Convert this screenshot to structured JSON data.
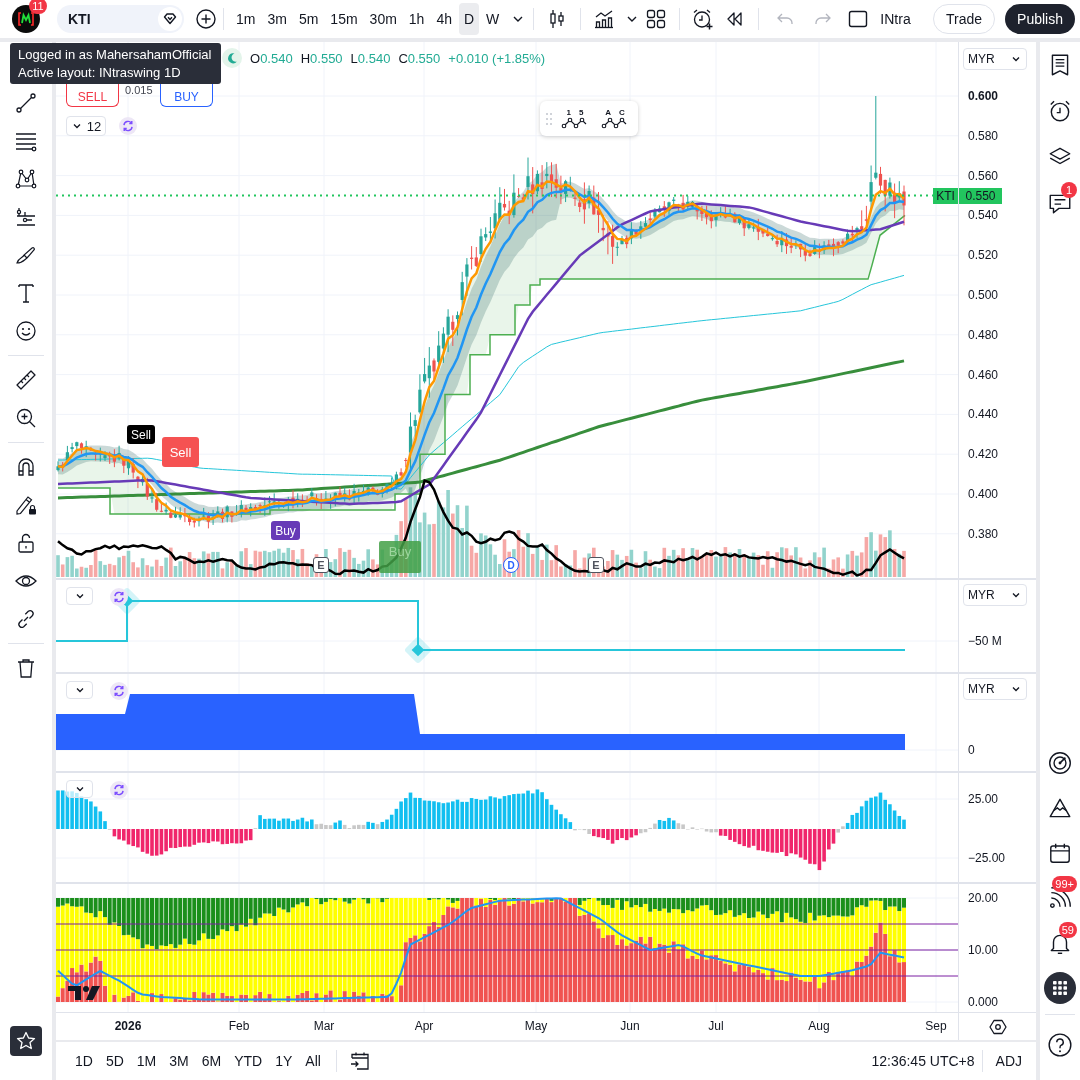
{
  "top_bar": {
    "avatar_badge": "11",
    "symbol": "KTI",
    "intervals": [
      {
        "label": "1m",
        "selected": false
      },
      {
        "label": "3m",
        "selected": false
      },
      {
        "label": "5m",
        "selected": false
      },
      {
        "label": "15m",
        "selected": false
      },
      {
        "label": "30m",
        "selected": false
      },
      {
        "label": "1h",
        "selected": false
      },
      {
        "label": "4h",
        "selected": false
      },
      {
        "label": "D",
        "selected": true
      },
      {
        "label": "W",
        "selected": false
      }
    ],
    "history_buttons": [
      {
        "kind": "undo",
        "disabled": true
      },
      {
        "kind": "redo",
        "disabled": true
      }
    ],
    "layout_name": "INtra",
    "actions": [
      {
        "label": "Trade",
        "kind": "secondary"
      },
      {
        "label": "Publish",
        "kind": "primary"
      }
    ]
  },
  "tooltip": {
    "lines": [
      "Logged in as MahersahamOfficial",
      "Active layout: INtraswing 1D"
    ]
  },
  "legend": {
    "ohlc": [
      {
        "label": "O",
        "value": "0.540"
      },
      {
        "label": "H",
        "value": "0.550"
      },
      {
        "label": "L",
        "value": "0.540"
      },
      {
        "label": "C",
        "value": "0.550"
      }
    ],
    "change": "+0.010 (+1.85%)"
  },
  "order_buttons": [
    {
      "kind": "sell",
      "label": "SELL"
    },
    {
      "kind": "buy",
      "label": "BUY"
    }
  ],
  "spread": "0.015",
  "indicator_count": "12",
  "wave_tools": [
    {
      "labels": [
        "1",
        "5"
      ]
    },
    {
      "labels": [
        "A",
        "C"
      ]
    }
  ],
  "chart_markers": [
    {
      "kind": "tag",
      "label": "Sell"
    },
    {
      "kind": "flag",
      "label": "Sell"
    },
    {
      "kind": "pill",
      "label": "Buy"
    },
    {
      "kind": "earnings",
      "label": "E"
    },
    {
      "kind": "dividend",
      "label": "D"
    },
    {
      "kind": "earnings",
      "label": "E"
    },
    {
      "kind": "block",
      "label": "Buy"
    }
  ],
  "price_axis": {
    "currency": "MYR",
    "ticks": [
      {
        "label": "0.600",
        "highlighted": true
      },
      {
        "label": "0.580",
        "highlighted": false
      },
      {
        "label": "0.560",
        "highlighted": false
      },
      {
        "label": "0.540",
        "highlighted": false
      },
      {
        "label": "0.520",
        "highlighted": false
      },
      {
        "label": "0.500",
        "highlighted": false
      },
      {
        "label": "0.480",
        "highlighted": false
      },
      {
        "label": "0.460",
        "highlighted": false
      },
      {
        "label": "0.440",
        "highlighted": false
      },
      {
        "label": "0.420",
        "highlighted": false
      },
      {
        "label": "0.400",
        "highlighted": false
      },
      {
        "label": "0.380",
        "highlighted": false
      }
    ],
    "last_price": {
      "symbol": "KTI",
      "value": "0.550"
    }
  },
  "sub_panes": [
    {
      "currency": "MYR",
      "ticks": [
        "−50 M"
      ]
    },
    {
      "currency": "MYR",
      "ticks": [
        "0"
      ]
    },
    {
      "ticks": [
        "25.00",
        "−25.00"
      ]
    },
    {
      "ticks": [
        "20.00",
        "10.00",
        "0.000"
      ]
    }
  ],
  "time_axis": [
    {
      "label": "2026",
      "kind": "year"
    },
    {
      "label": "Feb",
      "kind": "month"
    },
    {
      "label": "Mar",
      "kind": "month"
    },
    {
      "label": "Apr",
      "kind": "month"
    },
    {
      "label": "May",
      "kind": "month"
    },
    {
      "label": "Jun",
      "kind": "month"
    },
    {
      "label": "Jul",
      "kind": "month"
    },
    {
      "label": "Aug",
      "kind": "month"
    },
    {
      "label": "Sep",
      "kind": "month"
    }
  ],
  "bottom_bar": {
    "ranges": [
      "1D",
      "5D",
      "1M",
      "3M",
      "6M",
      "YTD",
      "1Y",
      "All"
    ],
    "clock": "12:36:45 UTC+8",
    "adjustment": "ADJ"
  },
  "right_sidebar": {
    "chat_badge": "1",
    "feed_badge": "99+",
    "alerts_badge": "59"
  }
}
